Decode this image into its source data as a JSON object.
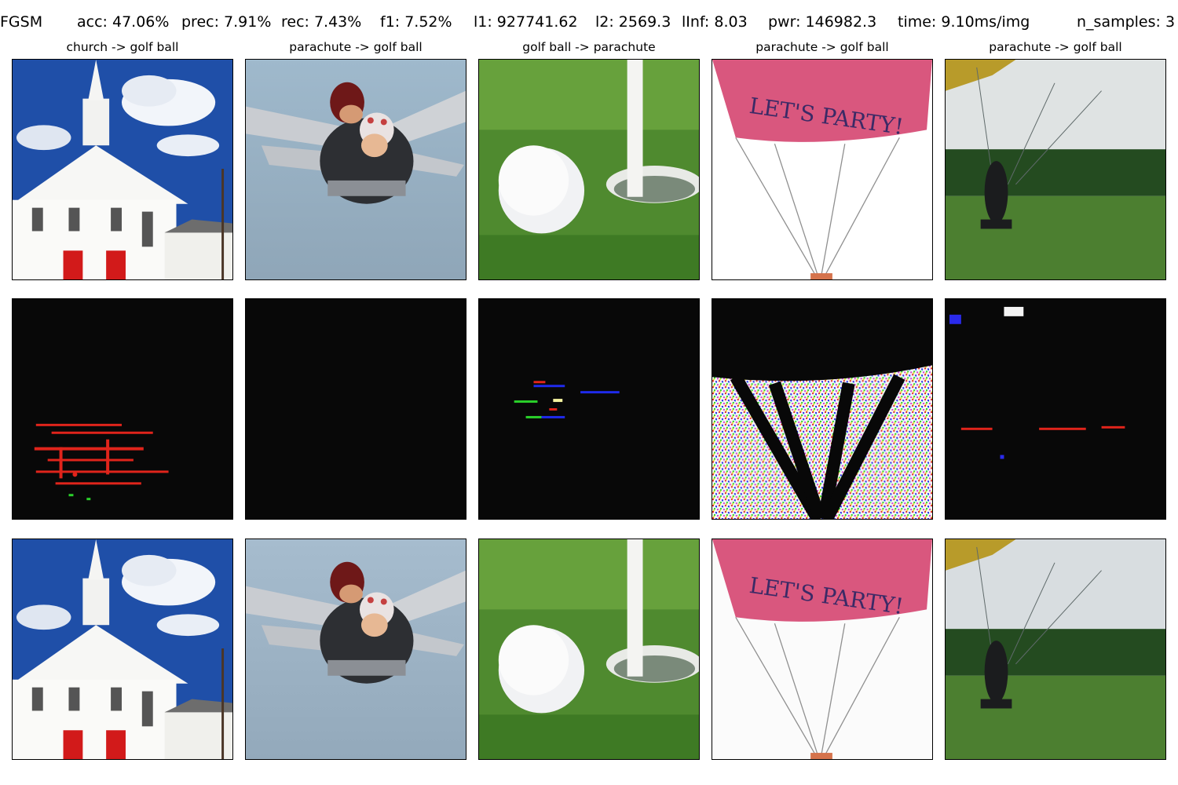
{
  "header": {
    "method": "FGSM",
    "acc": "acc: 47.06%",
    "prec": "prec: 7.91%",
    "rec": "rec: 7.43%",
    "f1": "f1: 7.52%",
    "l1": "l1: 927741.62",
    "l2": "l2: 2569.3",
    "linf": "lInf: 8.03",
    "pwr": "pwr: 146982.3",
    "time": "time: 9.10ms/img",
    "n_samples": "n_samples: 3"
  },
  "columns": [
    {
      "title": "church -> golf ball",
      "subject": "church"
    },
    {
      "title": "parachute -> golf ball",
      "subject": "skydivers"
    },
    {
      "title": "golf ball -> parachute",
      "subject": "golf-ball"
    },
    {
      "title": "parachute -> golf ball",
      "subject": "party-parachute"
    },
    {
      "title": "parachute -> golf ball",
      "subject": "parachutist"
    }
  ],
  "rows": [
    "original",
    "perturbation",
    "adversarial"
  ],
  "image_text": {
    "parachute_canopy": "LET'S PARTY!"
  },
  "colors": {
    "background": "#ffffff",
    "text": "#000000",
    "perturbation_bg": "#080808"
  }
}
